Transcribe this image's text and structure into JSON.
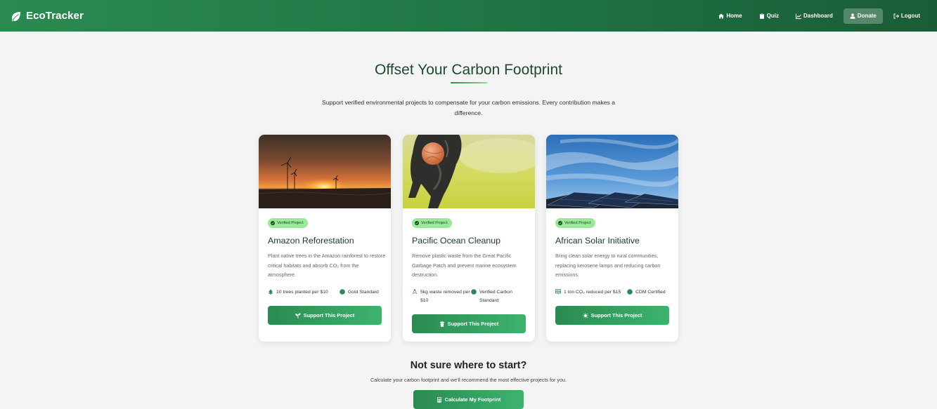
{
  "nav": {
    "brand": "EcoTracker",
    "links": [
      {
        "label": "Home",
        "icon": "home-icon"
      },
      {
        "label": "Quiz",
        "icon": "clipboard-icon"
      },
      {
        "label": "Dashboard",
        "icon": "chart-icon"
      },
      {
        "label": "Donate",
        "icon": "hand-heart-icon",
        "active": true
      },
      {
        "label": "Logout",
        "icon": "logout-icon"
      }
    ]
  },
  "hero": {
    "title": "Offset Your Carbon Footprint",
    "description": "Support verified environmental projects to compensate for your carbon emissions. Every contribution makes a difference."
  },
  "projects": [
    {
      "badge": "Verified Project",
      "title": "Amazon Reforestation",
      "description": "Plant native trees in the Amazon rainforest to restore critical habitats and absorb CO₂ from the atmosphere.",
      "stat1": "10 trees planted per $10",
      "stat1_icon": "tree-icon",
      "stat2": "Gold Standard",
      "stat2_icon": "certificate-icon",
      "button": "Support This Project",
      "button_icon": "seedling-icon"
    },
    {
      "badge": "Verified Project",
      "title": "Pacific Ocean Cleanup",
      "description": "Remove plastic waste from the Great Pacific Garbage Patch and prevent marine ecosystem destruction.",
      "stat1": "5kg waste removed per $10",
      "stat1_icon": "recycle-icon",
      "stat2": "Verified Carbon Standard",
      "stat2_icon": "certificate-icon",
      "button": "Support This Project",
      "button_icon": "trash-icon"
    },
    {
      "badge": "Verified Project",
      "title": "African Solar Initiative",
      "description": "Bring clean solar energy to rural communities, replacing kerosene lamps and reducing carbon emissions.",
      "stat1": "1 ton CO₂ reduced per $15",
      "stat1_icon": "solar-panel-icon",
      "stat2": "CDM Certified",
      "stat2_icon": "certificate-icon",
      "button": "Support This Project",
      "button_icon": "sun-icon"
    }
  ],
  "cta": {
    "title": "Not sure where to start?",
    "description": "Calculate your carbon footprint and we'll recommend the most effective projects for you.",
    "button": "Calculate My Footprint",
    "button_icon": "calculator-icon"
  },
  "colors": {
    "primary": "#2b8a52",
    "primary_dark": "#1a5c37",
    "badge_bg": "#9be89b",
    "title_green": "#1c4a2e"
  }
}
